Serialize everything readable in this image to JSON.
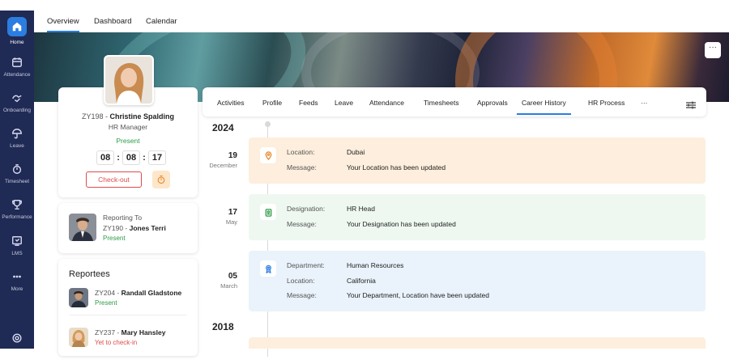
{
  "sidebar": {
    "items": [
      {
        "label": "Home",
        "icon": "home-icon"
      },
      {
        "label": "Attendance",
        "icon": "calendar-icon"
      },
      {
        "label": "Onboarding",
        "icon": "onboarding-icon"
      },
      {
        "label": "Leave",
        "icon": "umbrella-icon"
      },
      {
        "label": "Timesheet",
        "icon": "timer-icon"
      },
      {
        "label": "Performance",
        "icon": "trophy-icon"
      },
      {
        "label": "LMS",
        "icon": "lms-icon"
      },
      {
        "label": "More",
        "icon": "more-icon"
      }
    ],
    "bottom_icon": "support-icon"
  },
  "top_tabs": [
    "Overview",
    "Dashboard",
    "Calendar"
  ],
  "banner": {
    "more_label": "···"
  },
  "profile": {
    "id": "ZY198 - ",
    "name": "Christine Spalding",
    "role": "HR Manager",
    "status": "Present",
    "timer": {
      "h": "08",
      "m": "08",
      "s": "17",
      "sep": ":"
    },
    "checkout_label": "Check-out"
  },
  "reporting": {
    "label": "Reporting To",
    "id": "ZY190 - ",
    "name": "Jones Terri",
    "status": "Present"
  },
  "reportees": {
    "title": "Reportees",
    "items": [
      {
        "id": "ZY204 - ",
        "name": "Randall Gladstone",
        "status": "Present",
        "status_color": "#2e9b48"
      },
      {
        "id": "ZY237 - ",
        "name": "Mary Hansley",
        "status": "Yet to check-in",
        "status_color": "#e04a4a"
      }
    ]
  },
  "subtabs": [
    "Activities",
    "Profile",
    "Feeds",
    "Leave",
    "Attendance",
    "Timesheets",
    "Approvals",
    "Career History",
    "HR Process",
    "···"
  ],
  "timeline": {
    "years": [
      "2024",
      "2018"
    ],
    "entries": [
      {
        "day": "19",
        "month": "December",
        "color": "#fdeedd",
        "icon": "location-pin-icon",
        "rows": [
          {
            "k": "Location:",
            "v": "Dubai"
          },
          {
            "k": "Message:",
            "v": "Your Location has been updated"
          }
        ]
      },
      {
        "day": "17",
        "month": "May",
        "color": "#eef8f0",
        "icon": "badge-icon",
        "rows": [
          {
            "k": "Designation:",
            "v": "HR Head"
          },
          {
            "k": "Message:",
            "v": "Your Designation has been updated"
          }
        ]
      },
      {
        "day": "05",
        "month": "March",
        "color": "#eaf3fb",
        "icon": "department-icon",
        "rows": [
          {
            "k": "Department:",
            "v": "Human Resources"
          },
          {
            "k": "Location:",
            "v": "California"
          },
          {
            "k": "Message:",
            "v": "Your Department, Location have been updated"
          }
        ]
      }
    ]
  }
}
